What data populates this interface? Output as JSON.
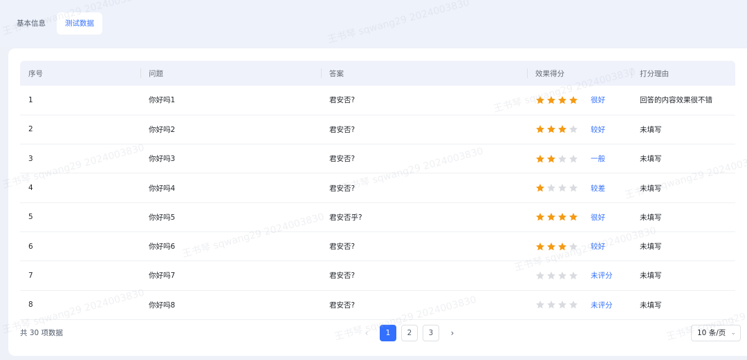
{
  "tabs": [
    {
      "label": "基本信息",
      "active": false
    },
    {
      "label": "测试数据",
      "active": true
    }
  ],
  "table": {
    "columns": [
      "序号",
      "问题",
      "答案",
      "效果得分",
      "打分理由"
    ],
    "rows": [
      {
        "index": "1",
        "question": "你好吗1",
        "answer": "君安否?",
        "stars": 4,
        "score_label": "很好",
        "reason": "回答的内容效果很不错"
      },
      {
        "index": "2",
        "question": "你好吗2",
        "answer": "君安否?",
        "stars": 3,
        "score_label": "较好",
        "reason": "未填写"
      },
      {
        "index": "3",
        "question": "你好吗3",
        "answer": "君安否?",
        "stars": 2,
        "score_label": "一般",
        "reason": "未填写"
      },
      {
        "index": "4",
        "question": "你好吗4",
        "answer": "君安否?",
        "stars": 1,
        "score_label": "较差",
        "reason": "未填写"
      },
      {
        "index": "5",
        "question": "你好吗5",
        "answer": "君安否乎?",
        "stars": 4,
        "score_label": "很好",
        "reason": "未填写"
      },
      {
        "index": "6",
        "question": "你好吗6",
        "answer": "君安否?",
        "stars": 3,
        "score_label": "较好",
        "reason": "未填写"
      },
      {
        "index": "7",
        "question": "你好吗7",
        "answer": "君安否?",
        "stars": 0,
        "score_label": "未评分",
        "reason": "未填写"
      },
      {
        "index": "8",
        "question": "你好吗8",
        "answer": "君安否?",
        "stars": 0,
        "score_label": "未评分",
        "reason": "未填写"
      }
    ],
    "max_stars": 4
  },
  "footer": {
    "total": "共 30 项数据",
    "pages": [
      "1",
      "2",
      "3"
    ],
    "current_page": "1",
    "prev_icon": "‹",
    "next_icon": "›",
    "page_size": "10 条/页"
  },
  "watermark": "王书琴 sqwang29 2024003830",
  "colors": {
    "accent": "#3370ff",
    "star_on": "#f59a13",
    "star_off": "#d9dbe0"
  }
}
